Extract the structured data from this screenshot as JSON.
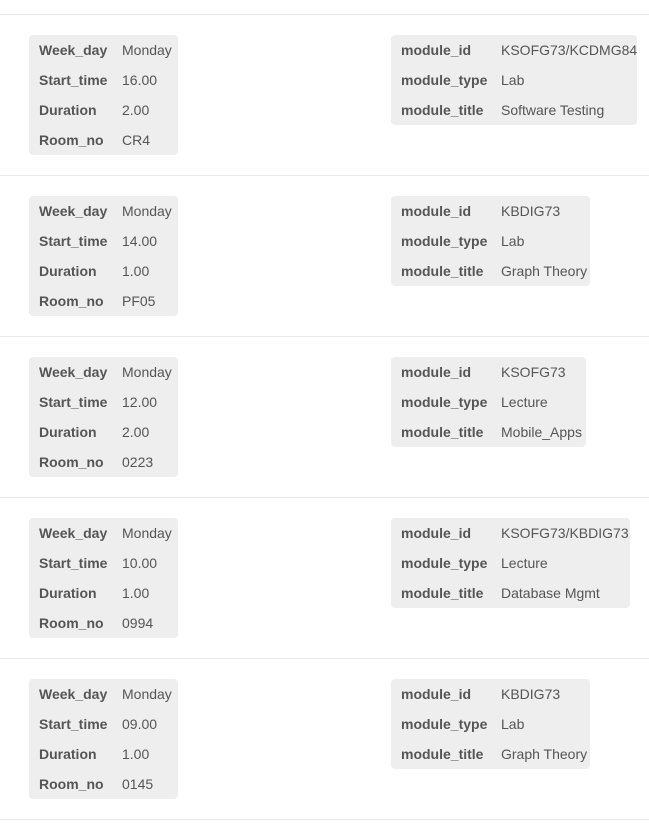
{
  "field_labels": {
    "week_day": "Week_day",
    "start_time": "Start_time",
    "duration": "Duration",
    "room_no": "Room_no",
    "module_id": "module_id",
    "module_type": "module_type",
    "module_title": "module_title"
  },
  "entries": [
    {
      "week_day": "Monday",
      "start_time": "16.00",
      "duration": "2.00",
      "room_no": "CR4",
      "module_id": "KSOFG73/KCDMG84",
      "module_type": "Lab",
      "module_title": "Software Testing"
    },
    {
      "week_day": "Monday",
      "start_time": "14.00",
      "duration": "1.00",
      "room_no": "PF05",
      "module_id": "KBDIG73",
      "module_type": "Lab",
      "module_title": "Graph Theory"
    },
    {
      "week_day": "Monday",
      "start_time": "12.00",
      "duration": "2.00",
      "room_no": "0223",
      "module_id": "KSOFG73",
      "module_type": "Lecture",
      "module_title": "Mobile_Apps"
    },
    {
      "week_day": "Monday",
      "start_time": "10.00",
      "duration": "1.00",
      "room_no": "0994",
      "module_id": "KSOFG73/KBDIG73",
      "module_type": "Lecture",
      "module_title": "Database Mgmt"
    },
    {
      "week_day": "Monday",
      "start_time": "09.00",
      "duration": "1.00",
      "room_no": "0145",
      "module_id": "KBDIG73",
      "module_type": "Lab",
      "module_title": "Graph Theory"
    }
  ]
}
